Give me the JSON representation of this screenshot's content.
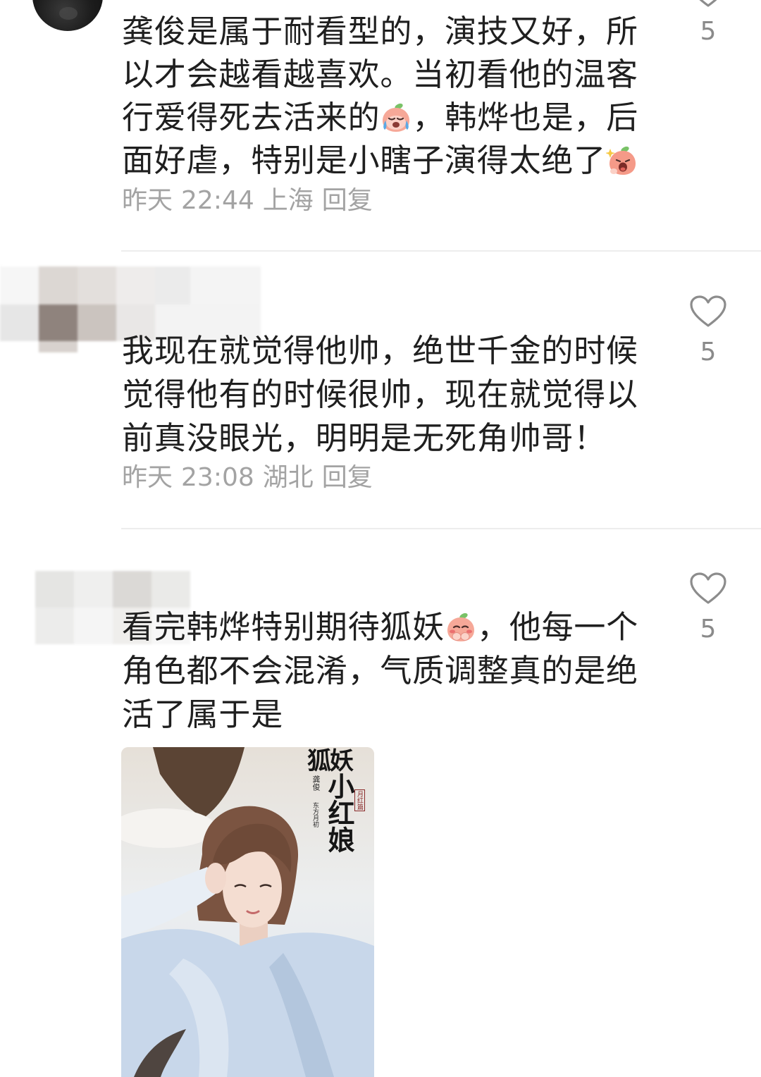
{
  "theme": {
    "background": "#ffffff",
    "text_color": "#1f1f1f",
    "meta_color": "#a3a3a3",
    "count_color": "#8a8a8a",
    "heart_color": "#8c8c8c",
    "divider_color": "#ededed"
  },
  "comments": [
    {
      "avatar_icon": "user-avatar",
      "lines": [
        {
          "text": "龚俊是属于耐看型的，演技又好，所"
        },
        {
          "text": "以才会越看越喜欢。当初看他的温客"
        },
        {
          "before": "行爱得死去活来的",
          "emoji": "crying-peach-emoji-icon",
          "after": "，韩烨也是，后"
        },
        {
          "before": "面好虐，特别是小瞎子演得太绝了",
          "emoji": "shouting-peach-emoji-icon"
        }
      ],
      "meta": {
        "date": "昨天",
        "time": "22:44",
        "location": "上海",
        "reply_label": "回复"
      },
      "likes": {
        "icon": "heart-outline-icon",
        "count": "5"
      }
    },
    {
      "avatar_icon": "blurred-avatar",
      "lines": [
        {
          "text": "我现在就觉得他帅，绝世千金的时候"
        },
        {
          "text": "觉得他有的时候很帅，现在就觉得以"
        },
        {
          "text": "前真没眼光，明明是无死角帅哥！"
        }
      ],
      "meta": {
        "date": "昨天",
        "time": "23:08",
        "location": "湖北",
        "reply_label": "回复"
      },
      "likes": {
        "icon": "heart-outline-icon",
        "count": "5"
      }
    },
    {
      "avatar_icon": "blurred-avatar",
      "lines": [
        {
          "before": "看完韩烨特别期待狐妖",
          "emoji": "blushing-peach-emoji-icon",
          "after": "，他每一个"
        },
        {
          "text": "角色都不会混淆，气质调整真的是绝"
        },
        {
          "text": "活了属于是"
        }
      ],
      "likes": {
        "icon": "heart-outline-icon",
        "count": "5"
      },
      "image": {
        "title_top": "狐妖",
        "title_main": "小红娘",
        "actor": "龚俊",
        "role": "东方月初",
        "subtitle": "月红篇"
      }
    }
  ]
}
